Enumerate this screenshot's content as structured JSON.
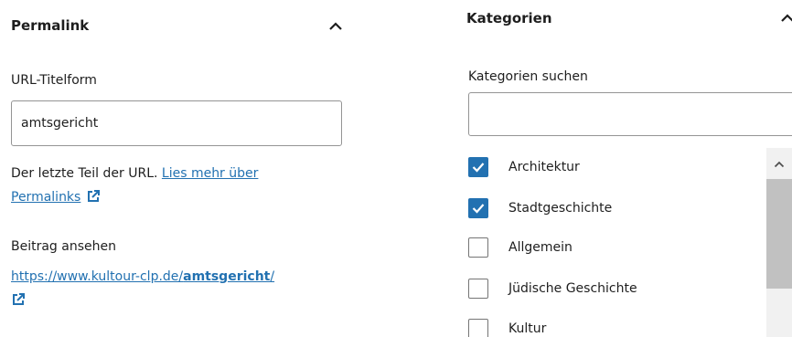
{
  "permalink": {
    "title": "Permalink",
    "slug_label": "URL-Titelform",
    "slug_value": "amtsgericht",
    "help_prefix": "Der letzte Teil der URL. ",
    "help_link_line1": "Lies mehr über",
    "help_link_line2": "Permalinks",
    "view_label": "Beitrag ansehen",
    "view_url_base": "https://www.kultour-clp.de/",
    "view_url_slug": "amtsgericht",
    "view_url_end": "/"
  },
  "categories": {
    "title": "Kategorien",
    "search_label": "Kategorien suchen",
    "search_value": "",
    "items": [
      {
        "label": "Architektur",
        "checked": true
      },
      {
        "label": "Stadtgeschichte",
        "checked": true
      },
      {
        "label": "Allgemein",
        "checked": false
      },
      {
        "label": "Jüdische Geschichte",
        "checked": false
      },
      {
        "label": "Kultur",
        "checked": false
      }
    ]
  },
  "colors": {
    "accent": "#2271b1",
    "text": "#1e1e1e",
    "border": "#949494"
  }
}
